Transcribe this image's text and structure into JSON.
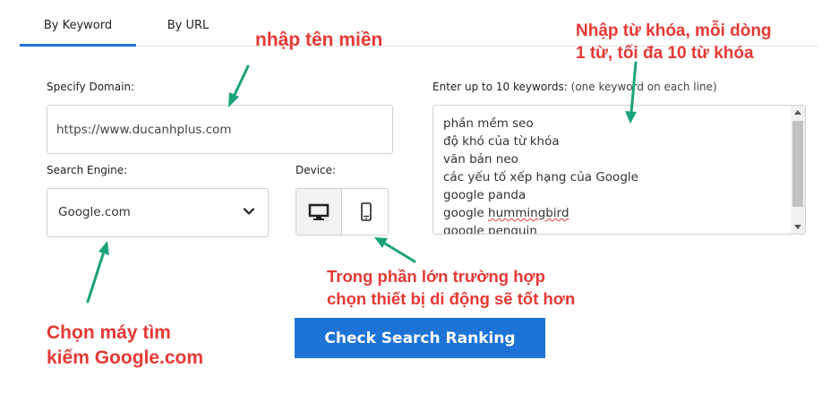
{
  "tabs": [
    {
      "label": "By Keyword",
      "active": true
    },
    {
      "label": "By URL",
      "active": false
    }
  ],
  "form": {
    "domain_label": "Specify Domain:",
    "domain_value": "https://www.ducanhplus.com",
    "engine_label": "Search Engine:",
    "engine_value": "Google.com",
    "device_label": "Device:",
    "device_selected": "mobile",
    "keywords_label": "Enter up to 10 keywords:",
    "keywords_hint": "(one keyword on each line)",
    "keywords": [
      "phần mềm seo",
      "độ khó của từ khóa",
      "văn bản neo",
      "các yếu tố xếp hạng của Google",
      "google panda",
      "google ",
      "google penguin"
    ],
    "keywords_spellcheck_word": "hummingbird",
    "submit_label": "Check Search Ranking"
  },
  "annotations": {
    "domain": "nhập tên miền",
    "keywords_line1": "Nhập từ khóa, mỗi dòng",
    "keywords_line2": "1 từ, tối đa 10 từ khóa",
    "device_line1": "Trong phần lớn trường hợp",
    "device_line2": "chọn thiết bị di động sẽ tốt hơn",
    "engine_line1": "Chọn máy tìm",
    "engine_line2": "kiếm Google.com"
  },
  "colors": {
    "accent": "#1e73d6",
    "annotation_text": "#e53935",
    "annotation_arrow": "#1aa37a"
  },
  "icons": {
    "engine_dropdown": "chevron-down-icon",
    "desktop": "monitor-icon",
    "mobile": "smartphone-icon"
  }
}
